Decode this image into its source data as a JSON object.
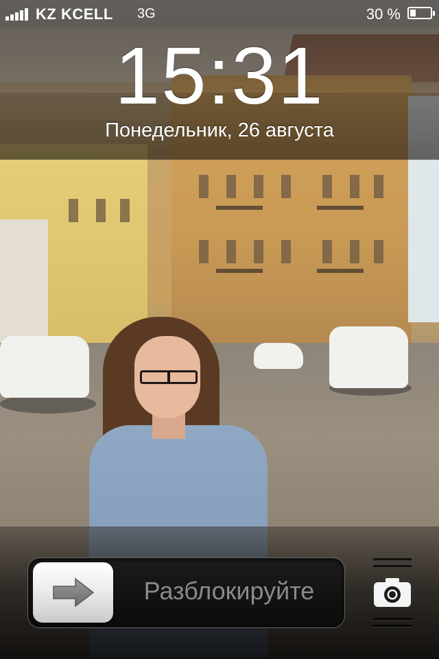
{
  "status_bar": {
    "carrier": "KZ KCELL",
    "network": "3G",
    "battery_percent_text": "30 %",
    "battery_level": 0.3,
    "signal_icon": "signal-bars-icon",
    "battery_icon": "battery-icon"
  },
  "lock_screen": {
    "time": "15:31",
    "date": "Понедельник, 26 августа"
  },
  "unlock_slider": {
    "label": "Разблокируйте",
    "knob_icon": "arrow-right-icon"
  },
  "camera": {
    "icon": "camera-icon"
  },
  "colors": {
    "slider_label": "#8a8a8a",
    "text": "#ffffff"
  }
}
